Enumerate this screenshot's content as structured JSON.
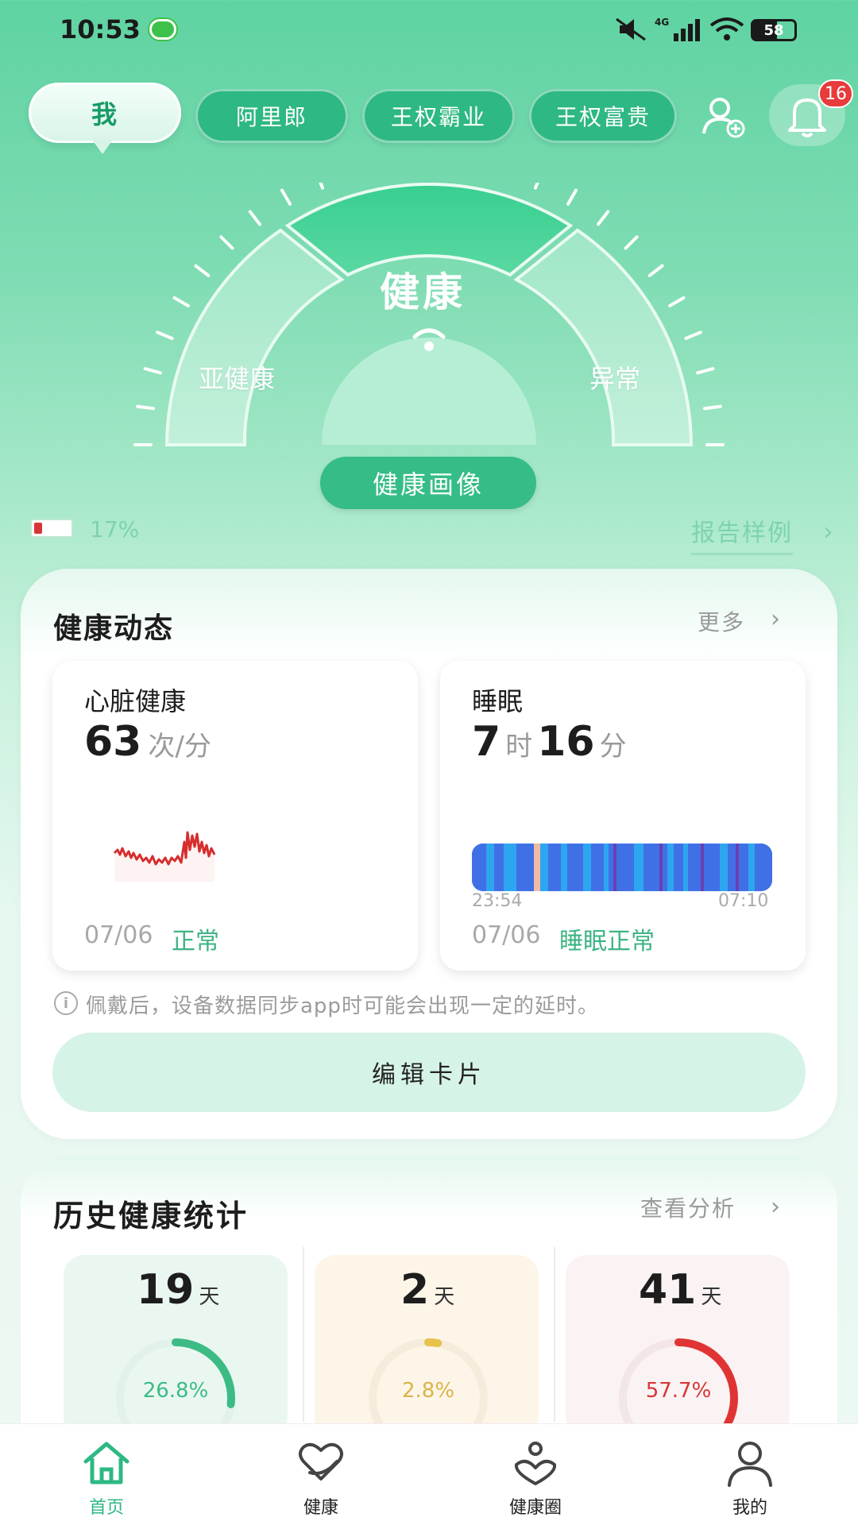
{
  "status_bar": {
    "time": "10:53",
    "network": "4G",
    "battery": "58"
  },
  "top_tabs": [
    {
      "label": "我",
      "active": true
    },
    {
      "label": "阿里郎"
    },
    {
      "label": "王权霸业"
    },
    {
      "label": "王权富贵"
    }
  ],
  "notifications": {
    "count": "16"
  },
  "gauge": {
    "left_label": "亚健康",
    "center_label": "健康",
    "right_label": "异常",
    "button_label": "健康画像"
  },
  "device": {
    "battery_percent": "17%"
  },
  "report_link": "报告样例",
  "health_dynamics": {
    "title": "健康动态",
    "more": "更多",
    "heart": {
      "title": "心脏健康",
      "value": "63",
      "unit": "次/分",
      "date": "07/06",
      "status": "正常"
    },
    "sleep": {
      "title": "睡眠",
      "hours": "7",
      "hours_unit": "时",
      "minutes": "16",
      "minutes_unit": "分",
      "start_time": "23:54",
      "end_time": "07:10",
      "date": "07/06",
      "status": "睡眠正常"
    },
    "info_text": "佩戴后，设备数据同步app时可能会出现一定的延时。",
    "edit_button": "编辑卡片"
  },
  "history": {
    "title": "历史健康统计",
    "analysis": "查看分析",
    "stats": [
      {
        "days": "19",
        "unit": "天",
        "percent": "26.8%",
        "fraction": 0.268,
        "color": "#3dbb85"
      },
      {
        "days": "2",
        "unit": "天",
        "percent": "2.8%",
        "fraction": 0.028,
        "color": "#e8c24a"
      },
      {
        "days": "41",
        "unit": "天",
        "percent": "57.7%",
        "fraction": 0.577,
        "color": "#e03434"
      }
    ]
  },
  "bottom_nav": [
    {
      "label": "首页",
      "icon": "home-icon",
      "active": true
    },
    {
      "label": "健康",
      "icon": "heart-hand-icon"
    },
    {
      "label": "健康圈",
      "icon": "heart-people-icon"
    },
    {
      "label": "我的",
      "icon": "user-icon"
    }
  ],
  "colors": {
    "accent": "#36bd87",
    "accent_dark": "#169a66"
  }
}
